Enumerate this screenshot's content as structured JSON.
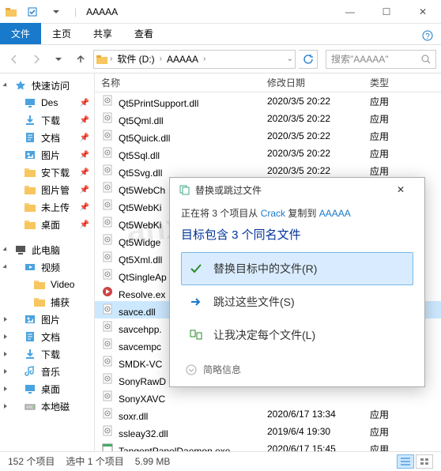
{
  "window": {
    "title": "AAAAA",
    "min": "—",
    "max": "☐",
    "close": "✕"
  },
  "ribbon": {
    "file": "文件",
    "tabs": [
      "主页",
      "共享",
      "查看"
    ]
  },
  "breadcrumb": {
    "parts": [
      "软件 (D:)",
      "AAAAA"
    ],
    "search_placeholder": "搜索\"AAAAA\""
  },
  "sidebar": {
    "quick_access": "快速访问",
    "items1": [
      {
        "label": "Des",
        "icon": "desktop",
        "color": "#4aa3df"
      },
      {
        "label": "下载",
        "icon": "download",
        "color": "#4aa3df"
      },
      {
        "label": "文档",
        "icon": "doc",
        "color": "#4aa3df"
      },
      {
        "label": "图片",
        "icon": "pic",
        "color": "#4aa3df"
      },
      {
        "label": "安下载",
        "icon": "folder",
        "color": "#f7c65f"
      },
      {
        "label": "图片管",
        "icon": "folder",
        "color": "#f7c65f"
      },
      {
        "label": "未上传",
        "icon": "folder",
        "color": "#f7c65f"
      },
      {
        "label": "桌面",
        "icon": "folder",
        "color": "#f7c65f"
      }
    ],
    "this_pc": "此电脑",
    "items2": [
      {
        "label": "视频",
        "icon": "video",
        "color": "#4aa3df"
      },
      {
        "label": "Video",
        "icon": "folder",
        "color": "#f7c65f"
      },
      {
        "label": "捕获",
        "icon": "folder",
        "color": "#f7c65f"
      },
      {
        "label": "图片",
        "icon": "pic",
        "color": "#4aa3df"
      },
      {
        "label": "文档",
        "icon": "doc",
        "color": "#4aa3df"
      },
      {
        "label": "下载",
        "icon": "download",
        "color": "#4aa3df"
      },
      {
        "label": "音乐",
        "icon": "music",
        "color": "#4aa3df"
      },
      {
        "label": "桌面",
        "icon": "desktop",
        "color": "#4aa3df"
      },
      {
        "label": "本地磁",
        "icon": "disk",
        "color": "#888"
      }
    ]
  },
  "columns": {
    "name": "名称",
    "date": "修改日期",
    "type": "类型"
  },
  "files": [
    {
      "name": "Qt5PrintSupport.dll",
      "date": "2020/3/5 20:22",
      "type": "应用",
      "ico": "dll"
    },
    {
      "name": "Qt5Qml.dll",
      "date": "2020/3/5 20:22",
      "type": "应用",
      "ico": "dll"
    },
    {
      "name": "Qt5Quick.dll",
      "date": "2020/3/5 20:22",
      "type": "应用",
      "ico": "dll"
    },
    {
      "name": "Qt5Sql.dll",
      "date": "2020/3/5 20:22",
      "type": "应用",
      "ico": "dll"
    },
    {
      "name": "Qt5Svg.dll",
      "date": "2020/3/5 20:22",
      "type": "应用",
      "ico": "dll"
    },
    {
      "name": "Qt5WebCh",
      "date": "",
      "type": "",
      "ico": "dll"
    },
    {
      "name": "Qt5WebKi",
      "date": "",
      "type": "",
      "ico": "dll"
    },
    {
      "name": "Qt5WebKi",
      "date": "",
      "type": "",
      "ico": "dll"
    },
    {
      "name": "Qt5Widge",
      "date": "",
      "type": "",
      "ico": "dll"
    },
    {
      "name": "Qt5Xml.dll",
      "date": "",
      "type": "",
      "ico": "dll"
    },
    {
      "name": "QtSingleAp",
      "date": "",
      "type": "",
      "ico": "dll"
    },
    {
      "name": "Resolve.ex",
      "date": "",
      "type": "",
      "ico": "exe"
    },
    {
      "name": "savce.dll",
      "date": "",
      "type": "",
      "ico": "dll",
      "sel": true
    },
    {
      "name": "savcehpp.",
      "date": "",
      "type": "",
      "ico": "dll"
    },
    {
      "name": "savcempc",
      "date": "",
      "type": "",
      "ico": "dll"
    },
    {
      "name": "SMDK-VC",
      "date": "",
      "type": "",
      "ico": "dll"
    },
    {
      "name": "SonyRawD",
      "date": "",
      "type": "",
      "ico": "dll"
    },
    {
      "name": "SonyXAVC",
      "date": "",
      "type": "",
      "ico": "dll"
    },
    {
      "name": "soxr.dll",
      "date": "2020/6/17 13:34",
      "type": "应用",
      "ico": "dll"
    },
    {
      "name": "ssleay32.dll",
      "date": "2019/6/4 19:30",
      "type": "应用",
      "ico": "dll"
    },
    {
      "name": "TangentPanelDaemon.exe",
      "date": "2020/6/17 15:45",
      "type": "应用",
      "ico": "exe"
    }
  ],
  "dialog": {
    "title": "替换或跳过文件",
    "msg_pre": "正在将 3 个项目从 ",
    "msg_src": "Crack",
    "msg_mid": " 复制到 ",
    "msg_dst": "AAAAA",
    "heading": "目标包含 3 个同名文件",
    "opt_replace": "替换目标中的文件(R)",
    "opt_skip": "跳过这些文件(S)",
    "opt_decide": "让我决定每个文件(L)",
    "more": "简略信息"
  },
  "status": {
    "count": "152 个项目",
    "sel": "选中 1 个项目",
    "size": "5.99 MB"
  },
  "watermark": "anxz.com"
}
